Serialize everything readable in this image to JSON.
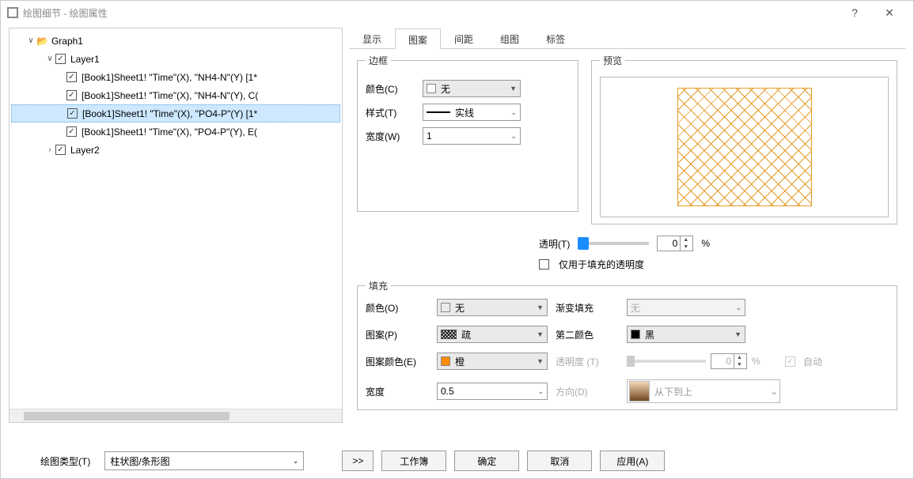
{
  "window": {
    "title": "绘图细节 - 绘图属性",
    "help": "?",
    "close": "✕"
  },
  "tree": {
    "root": "Graph1",
    "layer1": "Layer1",
    "layer2": "Layer2",
    "items": [
      "[Book1]Sheet1! \"Time\"(X), \"NH4-N\"(Y) [1*",
      "[Book1]Sheet1! \"Time\"(X), \"NH4-N\"(Y), C(",
      "[Book1]Sheet1! \"Time\"(X), \"PO4-P\"(Y) [1*",
      "[Book1]Sheet1! \"Time\"(X), \"PO4-P\"(Y), E("
    ]
  },
  "tabs": [
    "显示",
    "图案",
    "间距",
    "组图",
    "标签"
  ],
  "active_tab": 1,
  "border": {
    "legend": "边框",
    "color_label": "颜色(C)",
    "color_value": "无",
    "style_label": "样式(T)",
    "style_value": "实线",
    "width_label": "宽度(W)",
    "width_value": "1"
  },
  "preview": {
    "legend": "预览"
  },
  "transparency": {
    "label": "透明(T)",
    "value": "0",
    "pct": "%",
    "fill_only": "仅用于填充的透明度"
  },
  "fill": {
    "legend": "填充",
    "color_label": "颜色(O)",
    "color_value": "无",
    "pattern_label": "图案(P)",
    "pattern_value": "疏",
    "pat_color_label": "图案颜色(E)",
    "pat_color_value": "橙",
    "pat_color_hex": "#ff8c00",
    "width_label": "宽度",
    "width_value": "0.5",
    "grad_label": "渐变填充",
    "grad_value": "无",
    "color2_label": "第二颜色",
    "color2_value": "黑",
    "trans2_label": "透明度 (T)",
    "trans2_value": "0",
    "auto_label": "自动",
    "dir_label": "方向(D)",
    "dir_value": "从下到上"
  },
  "footer": {
    "plot_type_label": "绘图类型(T)",
    "plot_type_value": "柱状图/条形图",
    "expand": ">>",
    "workbook": "工作簿",
    "ok": "确定",
    "cancel": "取消",
    "apply": "应用(A)"
  }
}
